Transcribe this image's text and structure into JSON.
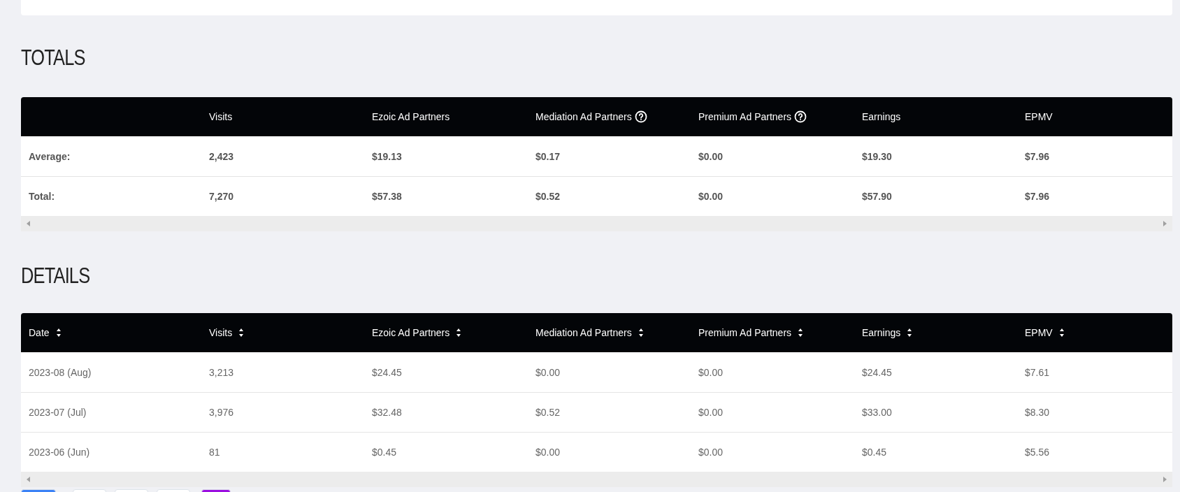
{
  "totals": {
    "title": "TOTALS",
    "columns": [
      {},
      {
        "label": "Visits",
        "help": false
      },
      {
        "label": "Ezoic Ad Partners",
        "help": false
      },
      {
        "label": "Mediation Ad Partners",
        "help": true
      },
      {
        "label": "Premium Ad Partners",
        "help": true
      },
      {
        "label": "Earnings",
        "help": false
      },
      {
        "label": "EPMV",
        "help": false
      }
    ],
    "rows": [
      [
        "Average:",
        "2,423",
        "$19.13",
        "$0.17",
        "$0.00",
        "$19.30",
        "$7.96"
      ],
      [
        "Total:",
        "7,270",
        "$57.38",
        "$0.52",
        "$0.00",
        "$57.90",
        "$7.96"
      ]
    ]
  },
  "details": {
    "title": "DETAILS",
    "columns": [
      {
        "label": "Date",
        "sortable": true
      },
      {
        "label": "Visits",
        "sortable": true
      },
      {
        "label": "Ezoic Ad Partners",
        "sortable": true
      },
      {
        "label": "Mediation Ad Partners",
        "sortable": true
      },
      {
        "label": "Premium Ad Partners",
        "sortable": true
      },
      {
        "label": "Earnings",
        "sortable": true
      },
      {
        "label": "EPMV",
        "sortable": true
      }
    ],
    "rows": [
      [
        "2023-08 (Aug)",
        "3,213",
        "$24.45",
        "$0.00",
        "$0.00",
        "$24.45",
        "$7.61"
      ],
      [
        "2023-07 (Jul)",
        "3,976",
        "$32.48",
        "$0.52",
        "$0.00",
        "$33.00",
        "$8.30"
      ],
      [
        "2023-06 (Jun)",
        "81",
        "$0.45",
        "$0.00",
        "$0.00",
        "$0.45",
        "$5.56"
      ]
    ]
  },
  "bottom_buttons": [
    {
      "color": "#3b82f6"
    },
    {
      "color": "#ffffff"
    },
    {
      "color": "#ffffff"
    },
    {
      "color": "#ffffff"
    },
    {
      "color": "#9b0fe0"
    }
  ]
}
